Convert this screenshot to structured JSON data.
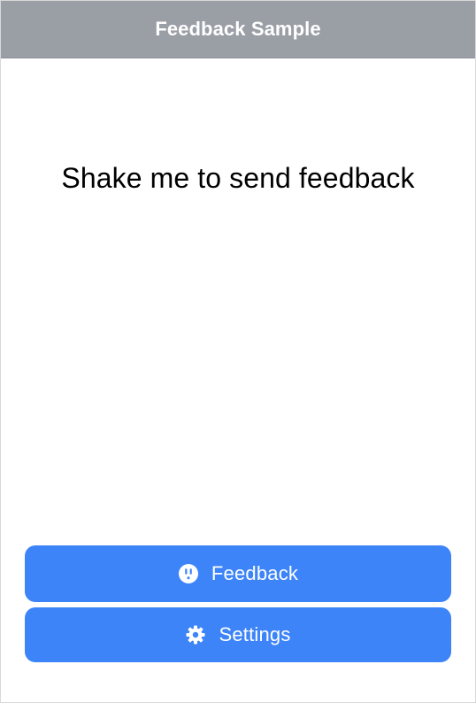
{
  "header": {
    "title": "Feedback Sample"
  },
  "main": {
    "message": "Shake me to send feedback"
  },
  "buttons": {
    "feedback": {
      "label": "Feedback",
      "icon": "feedback-icon"
    },
    "settings": {
      "label": "Settings",
      "icon": "gear-icon"
    }
  },
  "colors": {
    "header_bg": "#9a9ea5",
    "button_bg": "#3c84f7",
    "text": "#000000",
    "button_text": "#ffffff"
  }
}
